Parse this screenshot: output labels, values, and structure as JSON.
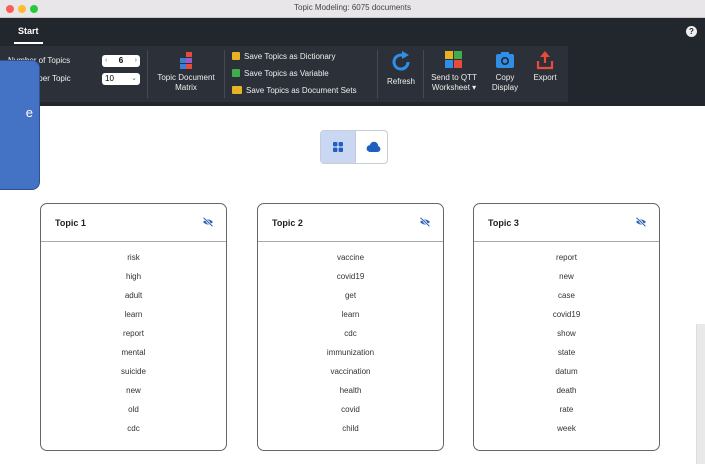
{
  "window": {
    "title": "Topic Modeling: 6075 documents"
  },
  "ribbon": {
    "tab": "Start",
    "help_glyph": "?"
  },
  "params": {
    "num_topics_label": "Number of Topics",
    "num_topics_value": "6",
    "words_label": "n-Words per Topic",
    "words_value": "10"
  },
  "toolbar": {
    "matrix_line1": "Topic Document",
    "matrix_line2": "Matrix",
    "save_dictionary": "Save Topics as Dictionary",
    "save_variable": "Save Topics as Variable",
    "save_document_sets": "Save Topics as Document Sets",
    "refresh": "Refresh",
    "send_line1": "Send to QTT",
    "send_line2": "Worksheet",
    "copy_line1": "Copy",
    "copy_line2": "Display",
    "export": "Export"
  },
  "callout": {
    "text": "e"
  },
  "view_toggle": {
    "grid_icon": "grid-icon",
    "cloud_icon": "cloud-icon"
  },
  "colors": {
    "accent": "#4472c4",
    "ribbon": "#22262d",
    "toggle_selected": "#c9d7f2",
    "eye": "#2c5fb3"
  },
  "topics": [
    {
      "title": "Topic 1",
      "words": [
        "risk",
        "high",
        "adult",
        "learn",
        "report",
        "mental",
        "suicide",
        "new",
        "old",
        "cdc"
      ]
    },
    {
      "title": "Topic 2",
      "words": [
        "vaccine",
        "covid19",
        "get",
        "learn",
        "cdc",
        "immunization",
        "vaccination",
        "health",
        "covid",
        "child"
      ]
    },
    {
      "title": "Topic 3",
      "words": [
        "report",
        "new",
        "case",
        "covid19",
        "show",
        "state",
        "datum",
        "death",
        "rate",
        "week"
      ]
    }
  ]
}
